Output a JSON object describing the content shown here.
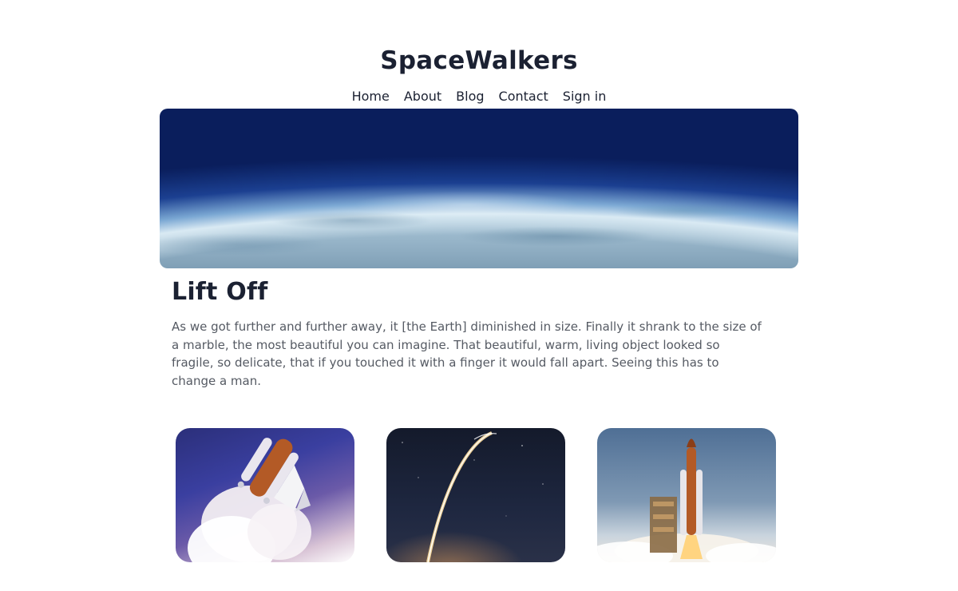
{
  "site": {
    "title": "SpaceWalkers"
  },
  "nav": {
    "items": [
      {
        "label": "Home"
      },
      {
        "label": "About"
      },
      {
        "label": "Blog"
      },
      {
        "label": "Contact"
      },
      {
        "label": "Sign in"
      }
    ]
  },
  "article": {
    "title": "Lift Off",
    "body": "As we got further and further away, it [the Earth] diminished in size. Finally it shrank to the size of a marble, the most beautiful you can imagine. That beautiful, warm, living object looked so fragile, so delicate, that if you touched it with a finger it would fall apart. Seeing this has to change a man."
  },
  "images": {
    "hero": {
      "name": "earth-horizon-image"
    },
    "cards": [
      {
        "name": "space-shuttle-image"
      },
      {
        "name": "rocket-trail-image"
      },
      {
        "name": "launch-pad-image"
      }
    ]
  },
  "colors": {
    "text_primary": "#1b2132",
    "text_secondary": "#555a63",
    "background": "#ffffff"
  }
}
